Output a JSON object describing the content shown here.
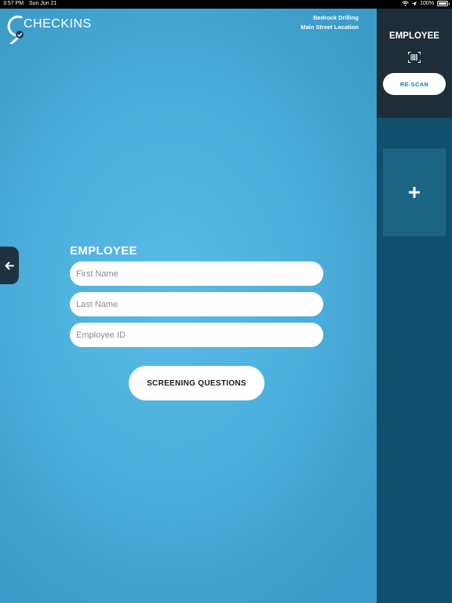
{
  "status_bar": {
    "time": "3:57 PM",
    "date": "Sun Jun 21",
    "battery": "100%",
    "icons": [
      "wifi-icon",
      "location-arrow-icon",
      "battery-icon"
    ]
  },
  "header": {
    "logo_text": "CHECKINS",
    "logo_icon": "map-pin-check-icon",
    "company": "Bedrock Drilling",
    "location": "Main Street Location"
  },
  "form": {
    "title": "EMPLOYEE",
    "first_name_placeholder": "First Name",
    "first_name_value": "",
    "last_name_placeholder": "Last Name",
    "last_name_value": "",
    "employee_id_placeholder": "Employee ID",
    "employee_id_value": "",
    "submit_label": "SCREENING QUESTIONS"
  },
  "back_button": {
    "icon": "arrow-left-icon"
  },
  "sidebar": {
    "title": "EMPLOYEE",
    "scan_icon": "barcode-scan-icon",
    "rescan_label": "RE-SCAN",
    "add_label": "+"
  },
  "colors": {
    "main_bg": "#4eb2de",
    "sidebar_bg": "#124f6c",
    "sidebar_header_bg": "#1e2d38",
    "add_tile_bg": "#1c6585",
    "accent_text": "#1d80a8"
  }
}
